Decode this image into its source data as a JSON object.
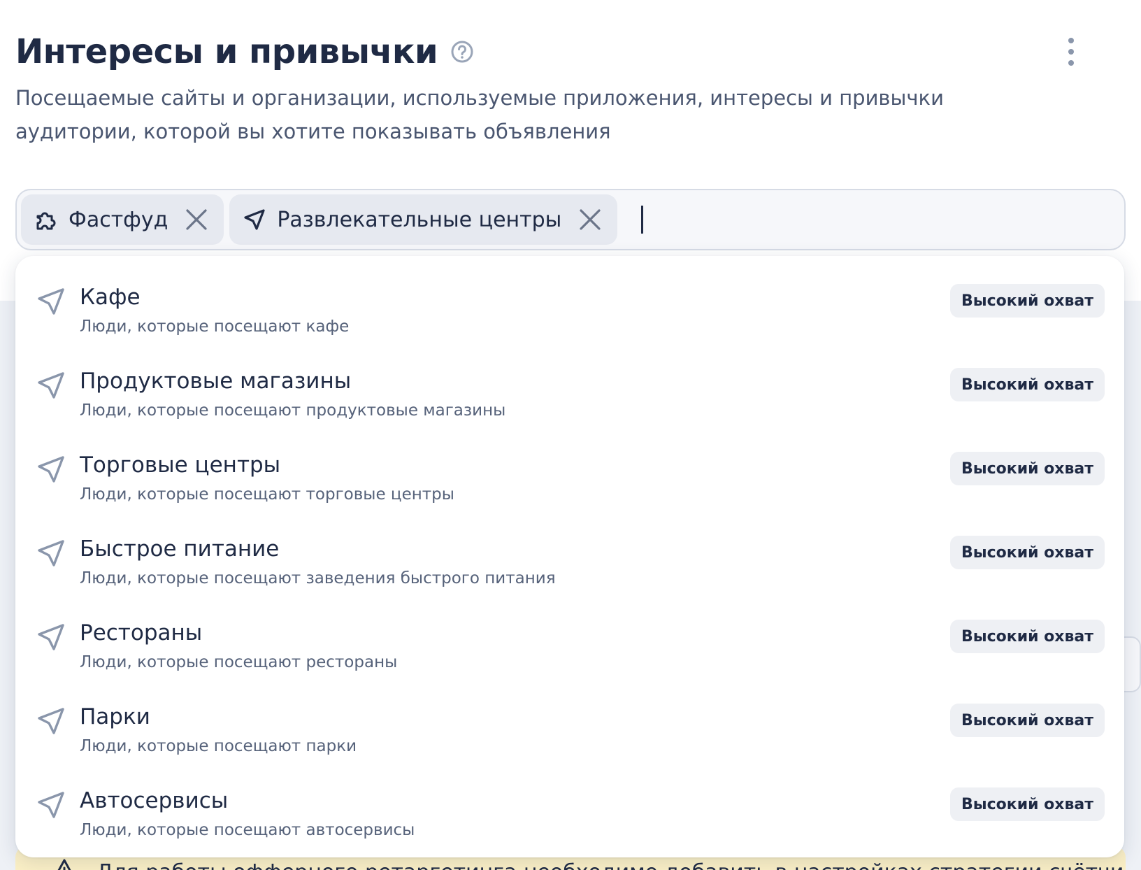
{
  "header": {
    "title": "Интересы и привычки",
    "subtitle": "Посещаемые сайты и организации, используемые приложения, интересы и привычки аудитории, которой вы хотите показывать объявления"
  },
  "selected_chips": [
    {
      "label": "Фастфуд",
      "icon": "puzzle-icon"
    },
    {
      "label": "Развлекательные центры",
      "icon": "location-arrow-icon"
    }
  ],
  "search": {
    "value": ""
  },
  "options": [
    {
      "title": "Кафе",
      "description": "Люди, которые посещают кафе",
      "badge": "Высокий охват",
      "icon": "location-arrow-icon"
    },
    {
      "title": "Продуктовые магазины",
      "description": "Люди, которые посещают продуктовые магазины",
      "badge": "Высокий охват",
      "icon": "location-arrow-icon"
    },
    {
      "title": "Торговые центры",
      "description": "Люди, которые посещают торговые центры",
      "badge": "Высокий охват",
      "icon": "location-arrow-icon"
    },
    {
      "title": "Быстрое питание",
      "description": "Люди, которые посещают заведения быстрого питания",
      "badge": "Высокий охват",
      "icon": "location-arrow-icon"
    },
    {
      "title": "Рестораны",
      "description": "Люди, которые посещают рестораны",
      "badge": "Высокий охват",
      "icon": "location-arrow-icon"
    },
    {
      "title": "Парки",
      "description": "Люди, которые посещают парки",
      "badge": "Высокий охват",
      "icon": "location-arrow-icon"
    },
    {
      "title": "Автосервисы",
      "description": "Люди, которые посещают автосервисы",
      "badge": "Высокий охват",
      "icon": "location-arrow-icon"
    }
  ],
  "warning": {
    "text": "Для работы офферного ретаргетинга необходимо добавить в настройках стратегии счётчик"
  },
  "colors": {
    "text_primary": "#1f2a44",
    "text_secondary": "#56627a",
    "badge_bg": "#eef0f4",
    "chip_bg": "#e6e9f0",
    "warning_bg": "#fbf0c6",
    "icon_muted": "#8a96ab"
  }
}
